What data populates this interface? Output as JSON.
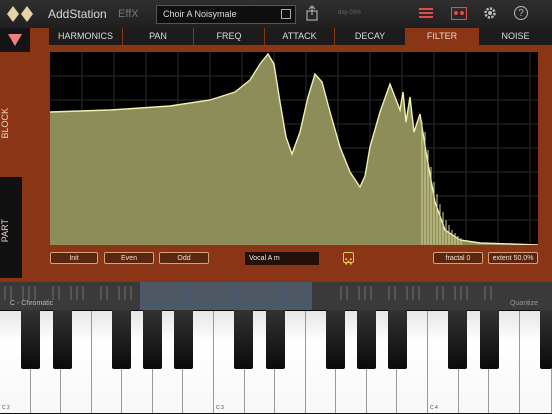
{
  "header": {
    "app_title": "AddStation",
    "effx_label": "EffX",
    "preset_name": "Choir A Noisymale",
    "dsp_text": "dsp 03%"
  },
  "side": {
    "block_label": "BLOCK",
    "part_label": "PART"
  },
  "tabs": [
    "HARMONICS",
    "PAN",
    "FREQ",
    "ATTACK",
    "DECAY",
    "FILTER",
    "NOISE"
  ],
  "active_tab": "FILTER",
  "controls": {
    "init_label": "Init",
    "even_label": "Even",
    "odd_label": "Odd",
    "filter_preset": "Vocal A m",
    "fractal_label": "fractal 0",
    "extent_label": "extent 50.0%"
  },
  "keyboard": {
    "scale_label": "C - Chromatic",
    "tuning_label": "Quantize",
    "octave_labels": [
      "C 2",
      "C 3",
      "C 4"
    ]
  },
  "colors": {
    "panel": "#8a3516",
    "curve_fill": "#8d8d5a",
    "curve_line": "#f2efb0"
  }
}
